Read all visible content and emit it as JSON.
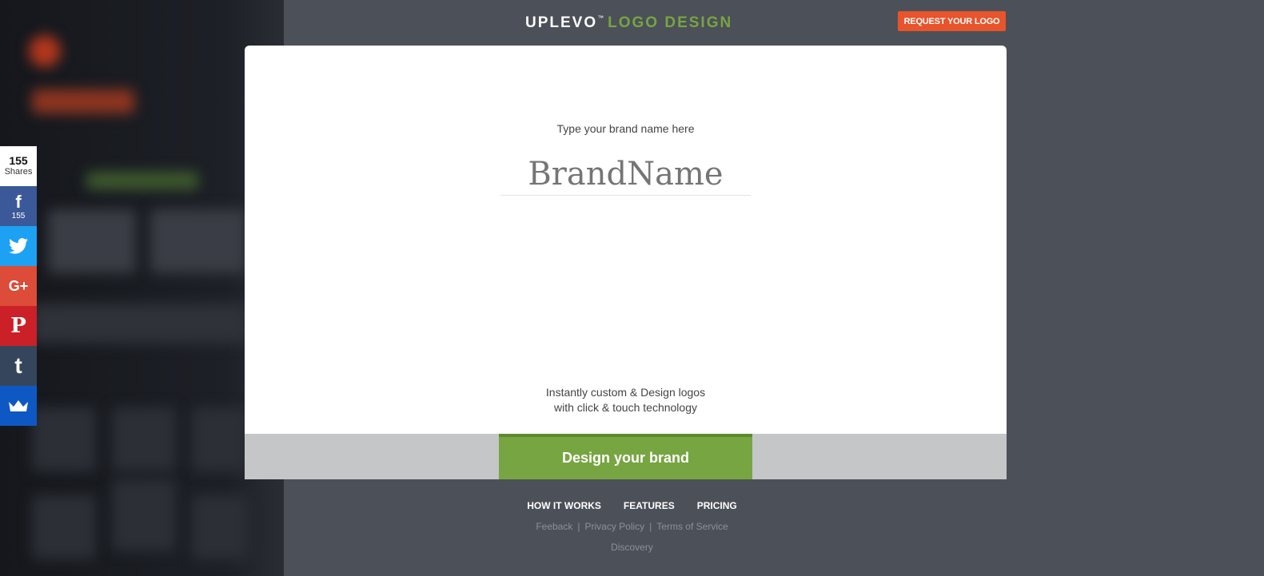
{
  "header": {
    "brand_primary": "UPLEVO",
    "brand_tm": "™",
    "brand_secondary": "LOGO DESIGN",
    "request_button": "REQUEST YOUR LOGO"
  },
  "modal": {
    "prompt": "Type your brand name here",
    "brand_placeholder": "BrandName",
    "tagline_line1": "Instantly custom & Design logos",
    "tagline_line2": "with click & touch technology",
    "cta_button": "Design your brand"
  },
  "footer": {
    "nav": [
      "HOW IT WORKS",
      "FEATURES",
      "PRICING"
    ],
    "links": [
      "Feeback",
      "Privacy Policy",
      "Terms of Service"
    ],
    "separator": "|",
    "discovery": "Discovery"
  },
  "share_bar": {
    "total_count": "155",
    "total_label": "Shares",
    "facebook_count": "155",
    "icons": [
      "facebook-icon",
      "twitter-icon",
      "google-plus-icon",
      "pinterest-icon",
      "tumblr-icon",
      "sumo-crown-icon"
    ]
  },
  "colors": {
    "accent_green": "#77a541",
    "request_orange": "#e8542b",
    "backdrop": "#4b4f58",
    "facebook": "#3b5998",
    "twitter": "#1da1f2",
    "google_plus": "#dd4b39",
    "pinterest": "#cb2027",
    "tumblr": "#35465c",
    "sumo": "#0e58c4"
  }
}
